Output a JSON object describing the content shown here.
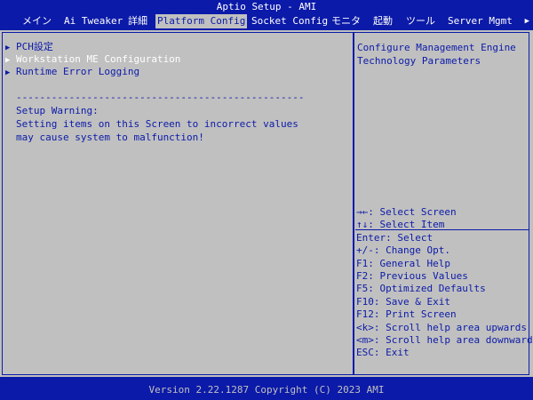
{
  "window": {
    "title": "Aptio Setup - AMI"
  },
  "tabs": [
    {
      "label": "メイン"
    },
    {
      "label": "Ai Tweaker"
    },
    {
      "label": "詳細"
    },
    {
      "label": "Platform Config",
      "active": true
    },
    {
      "label": "Socket Config"
    },
    {
      "label": "モニタ"
    },
    {
      "label": "起動"
    },
    {
      "label": "ツール"
    },
    {
      "label": "Server Mgmt"
    }
  ],
  "tab_scroll_icon": "right-triangle-icon",
  "menu": [
    {
      "label": "PCH設定",
      "selected": false
    },
    {
      "label": "Workstation ME Configuration",
      "selected": true
    },
    {
      "label": "Runtime Error Logging",
      "selected": false
    }
  ],
  "warning": {
    "separator": "-------------------------------------------------",
    "heading": "Setup Warning:",
    "line1": "Setting items on this Screen to incorrect values",
    "line2": "may cause system to malfunction!"
  },
  "help": {
    "line1": "Configure Management Engine",
    "line2": "Technology Parameters"
  },
  "keys": [
    "→←: Select Screen",
    "↑↓: Select Item",
    "Enter: Select",
    "+/-: Change Opt.",
    "F1: General Help",
    "F2: Previous Values",
    "F5: Optimized Defaults",
    "F10: Save & Exit",
    "F12: Print Screen",
    "<k>: Scroll help area upwards",
    "<m>: Scroll help area downwards",
    "ESC: Exit"
  ],
  "footer": {
    "version": "Version 2.22.1287 Copyright (C) 2023 AMI"
  },
  "colors": {
    "background": "#0b1aa8",
    "panel": "#c0c0c0",
    "text": "#0b1aa8",
    "highlight": "#ffffff"
  }
}
